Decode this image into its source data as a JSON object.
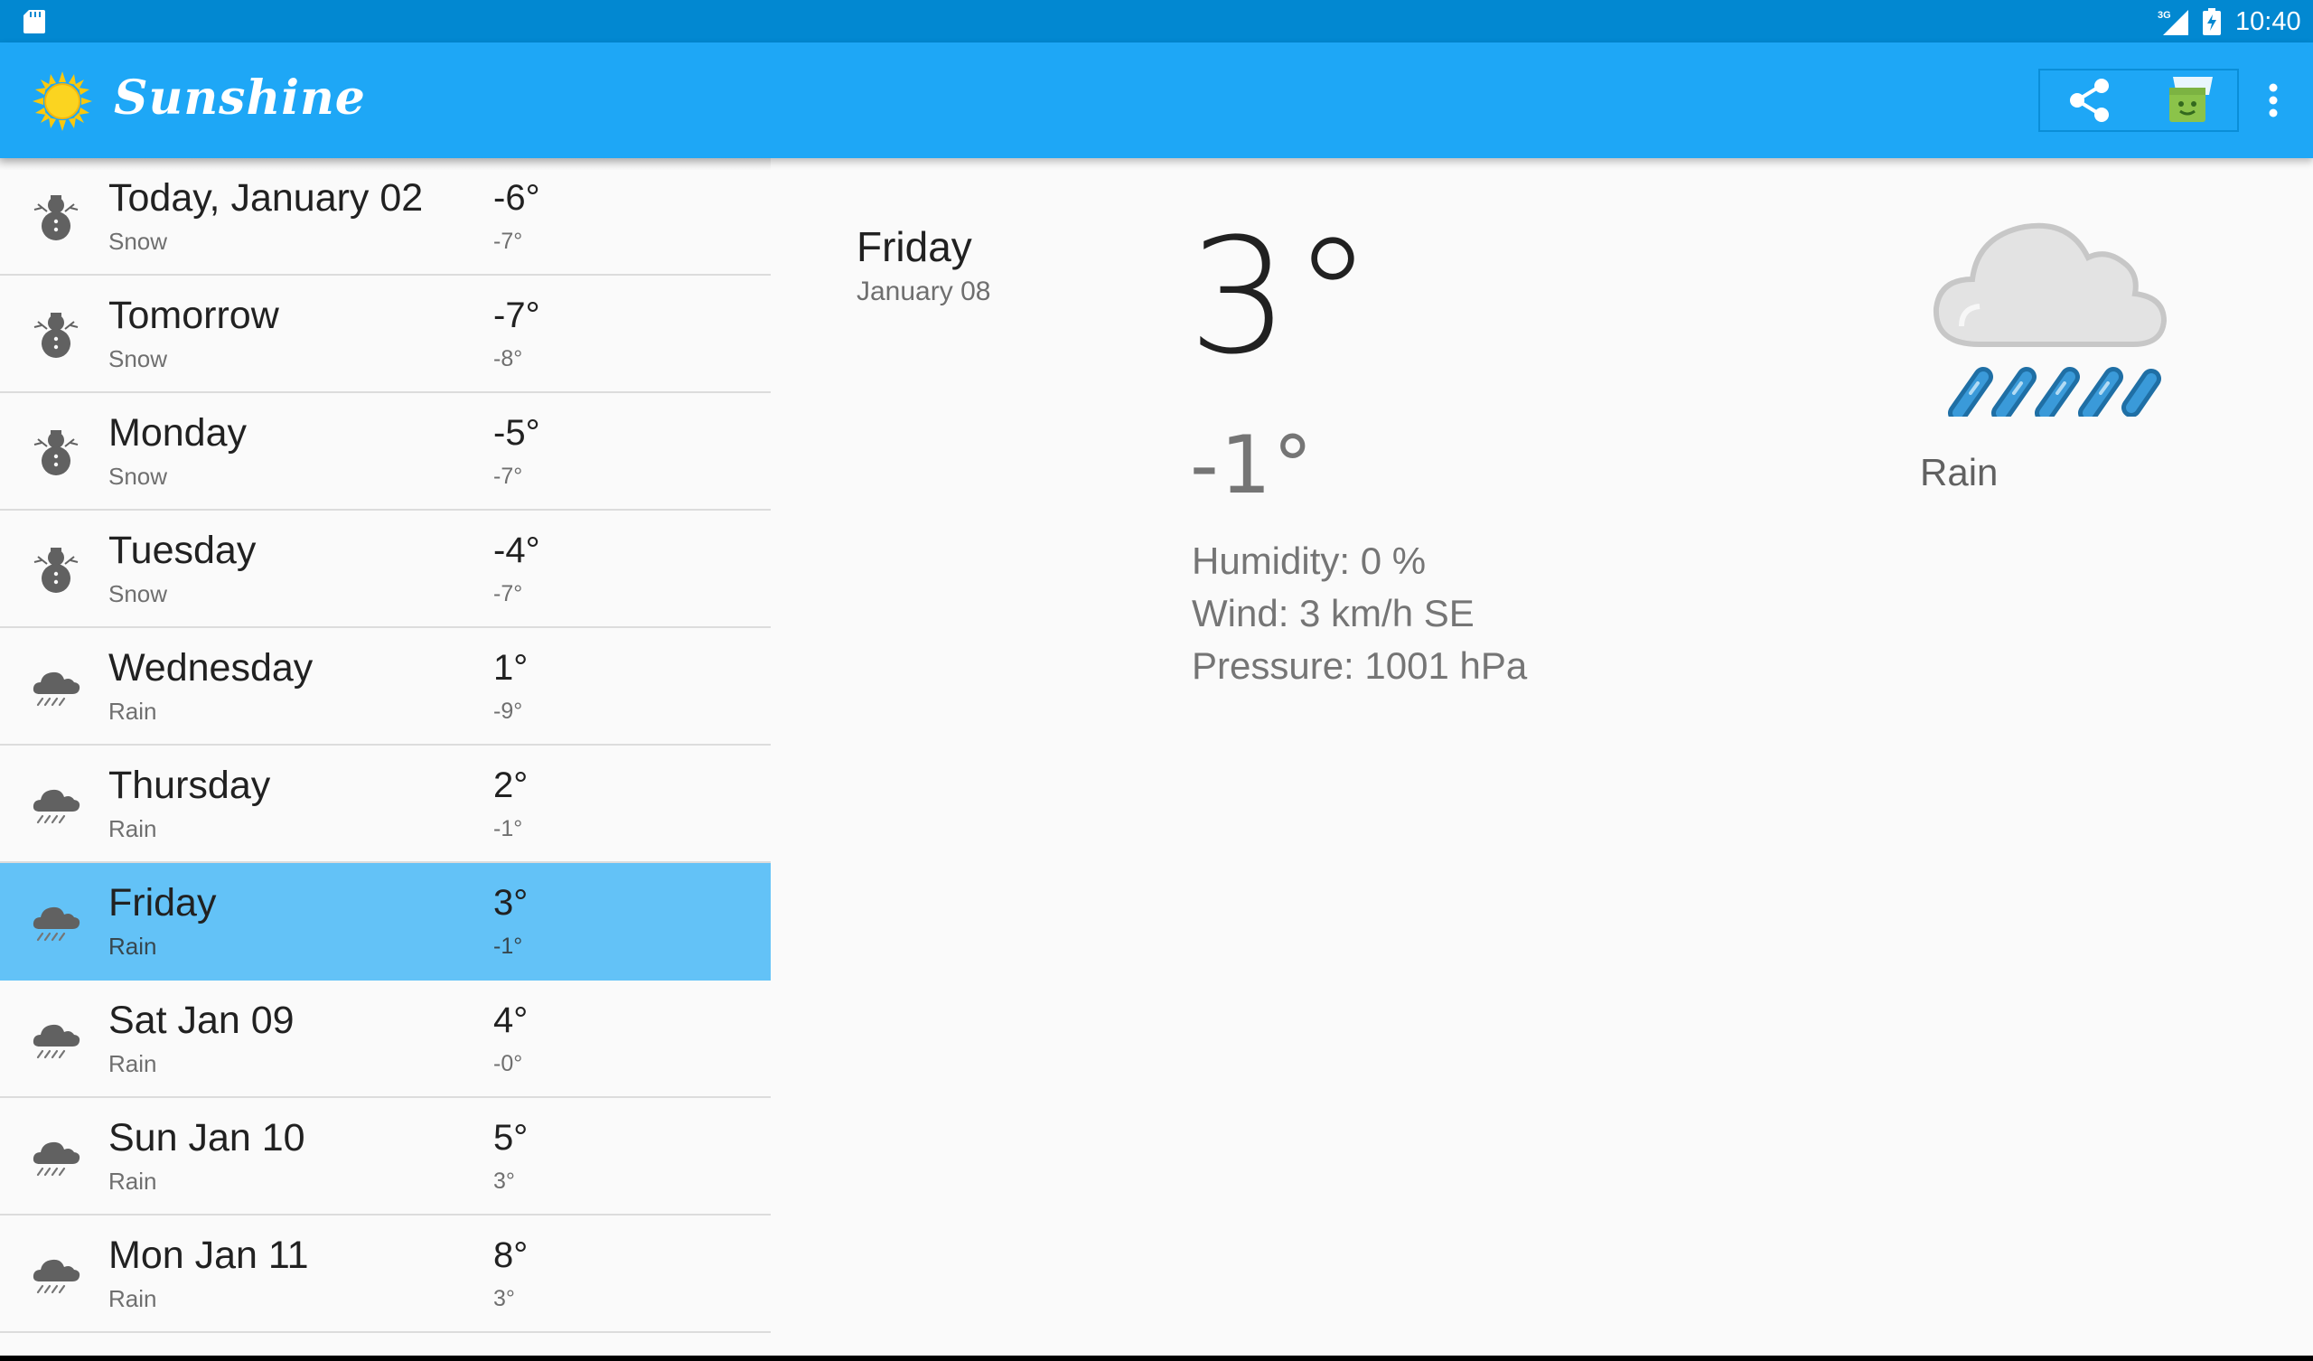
{
  "status_bar": {
    "time": "10:40",
    "network_label": "3G",
    "icons": [
      "sd-card-icon",
      "signal-icon",
      "battery-icon"
    ]
  },
  "app_bar": {
    "title": "Sunshine",
    "logo_icon": "sun-icon",
    "actions": [
      "share-icon",
      "shopping-cart-icon",
      "overflow-menu-icon"
    ]
  },
  "forecast": [
    {
      "day": "Today, January 02",
      "desc": "Snow",
      "high": "-6°",
      "low": "-7°",
      "icon": "snow-icon",
      "selected": false
    },
    {
      "day": "Tomorrow",
      "desc": "Snow",
      "high": "-7°",
      "low": "-8°",
      "icon": "snow-icon",
      "selected": false
    },
    {
      "day": "Monday",
      "desc": "Snow",
      "high": "-5°",
      "low": "-7°",
      "icon": "snow-icon",
      "selected": false
    },
    {
      "day": "Tuesday",
      "desc": "Snow",
      "high": "-4°",
      "low": "-7°",
      "icon": "snow-icon",
      "selected": false
    },
    {
      "day": "Wednesday",
      "desc": "Rain",
      "high": "1°",
      "low": "-9°",
      "icon": "rain-icon",
      "selected": false
    },
    {
      "day": "Thursday",
      "desc": "Rain",
      "high": "2°",
      "low": "-1°",
      "icon": "rain-icon",
      "selected": false
    },
    {
      "day": "Friday",
      "desc": "Rain",
      "high": "3°",
      "low": "-1°",
      "icon": "rain-icon",
      "selected": true
    },
    {
      "day": "Sat Jan 09",
      "desc": "Rain",
      "high": "4°",
      "low": "-0°",
      "icon": "rain-icon",
      "selected": false
    },
    {
      "day": "Sun Jan 10",
      "desc": "Rain",
      "high": "5°",
      "low": "3°",
      "icon": "rain-icon",
      "selected": false
    },
    {
      "day": "Mon Jan 11",
      "desc": "Rain",
      "high": "8°",
      "low": "3°",
      "icon": "rain-icon",
      "selected": false
    }
  ],
  "detail": {
    "day": "Friday",
    "date": "January 08",
    "high": "3°",
    "low": "-1°",
    "humidity": "Humidity: 0 %",
    "wind": "Wind: 3 km/h SE",
    "pressure": "Pressure: 1001 hPa",
    "description": "Rain",
    "art_icon": "rain-cloud-art-icon"
  },
  "colors": {
    "status_bar": "#0288d1",
    "app_bar": "#1ea7f6",
    "selected_row": "#63c2f7",
    "background": "#fafafa"
  }
}
